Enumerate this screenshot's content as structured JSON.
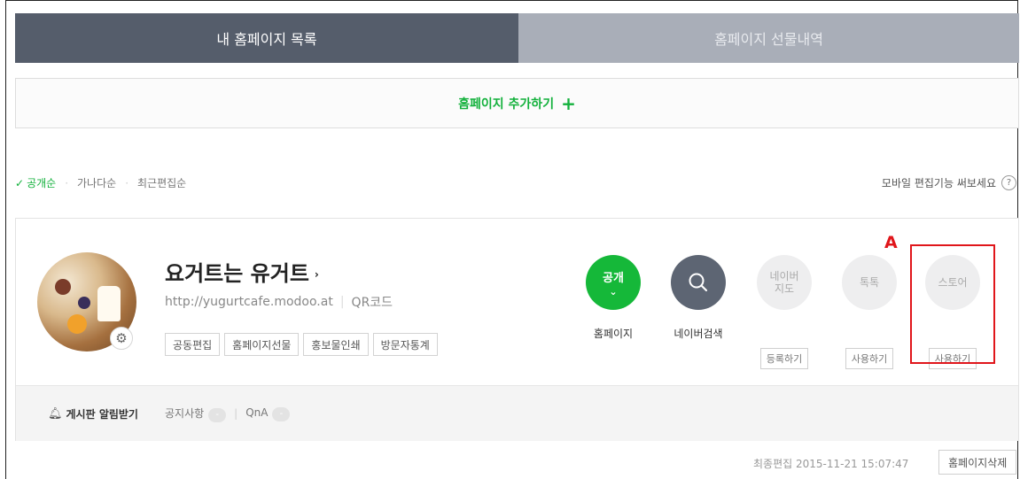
{
  "tabs": {
    "my_list": "내 홈페이지 목록",
    "gift_history": "홈페이지 선물내역"
  },
  "add_homepage": {
    "label": "홈페이지 추가하기",
    "icon": "+"
  },
  "sort": {
    "check_icon": "✓",
    "options": [
      "공개순",
      "가나다순",
      "최근편집순"
    ],
    "separator": "·"
  },
  "mobile_hint": {
    "text": "모바일 편집기능 써보세요",
    "help_icon": "?"
  },
  "site": {
    "title": "요거트는 유거트",
    "title_arrow": "›",
    "url": "http://yugurtcafe.modoo.at",
    "qr_label": "QR코드",
    "url_sep": "|",
    "actions": [
      "공동편집",
      "홈페이지선물",
      "홍보물인쇄",
      "방문자통계"
    ]
  },
  "services": {
    "public": {
      "circle_text": "공개",
      "chevron": "⌄",
      "label": "홈페이지"
    },
    "naver_search": {
      "label": "네이버검색"
    },
    "naver_map": {
      "line1": "네이버",
      "line2": "지도",
      "button": "등록하기"
    },
    "talktalk": {
      "circle_text": "톡톡",
      "button": "사용하기"
    },
    "store": {
      "circle_text": "스토어",
      "button": "사용하기"
    }
  },
  "annotation": {
    "marker": "A",
    "color": "#e0161b"
  },
  "footer": {
    "bell_icon": "🔔",
    "notify_label": "게시판 알림받기",
    "boards": [
      {
        "name": "공지사항",
        "count": "-"
      },
      {
        "name": "QnA",
        "count": "-"
      }
    ],
    "sep": "|"
  },
  "last_edit": "최종편집 2015-11-21 15:07:47",
  "delete_button": "홈페이지삭제",
  "colors": {
    "accent_green": "#15b839",
    "tab_active": "#555d6b",
    "tab_inactive": "#a9aeb8"
  }
}
